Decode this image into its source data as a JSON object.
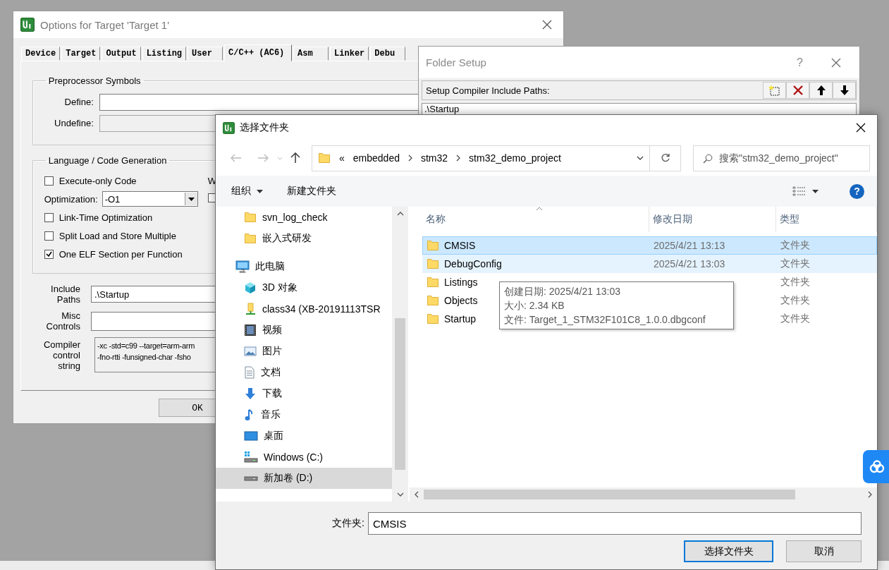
{
  "options_window": {
    "title": "Options for Target 'Target 1'",
    "tabs": [
      {
        "label": "Device",
        "selected": false
      },
      {
        "label": "Target",
        "selected": false
      },
      {
        "label": "Output",
        "selected": false
      },
      {
        "label": "Listing",
        "selected": false
      },
      {
        "label": "User",
        "selected": false
      },
      {
        "label": "C/C++ (AC6)",
        "selected": true
      },
      {
        "label": "Asm",
        "selected": false
      },
      {
        "label": "Linker",
        "selected": false
      },
      {
        "label": "Debu",
        "selected": false
      }
    ],
    "preprocessor": {
      "title": "Preprocessor Symbols",
      "define_label": "Define:",
      "undefine_label": "Undefine:",
      "undefine_disabled": true
    },
    "language": {
      "title": "Language / Code Generation",
      "options": [
        {
          "label": "Execute-only Code",
          "checked": false
        },
        {
          "label": "Link-Time Optimization",
          "checked": false
        },
        {
          "label": "Split Load and Store Multiple",
          "checked": false
        },
        {
          "label": "One ELF Section per Function",
          "checked": true
        }
      ],
      "optimization_label": "Optimization:",
      "optimization_value": "-O1",
      "column_2_label": "W",
      "column_2_checkbox_checked": false
    },
    "include_paths_label": "Include Paths",
    "include_paths_value": ".\\Startup",
    "misc_controls_label": "Misc Controls",
    "compiler_string_label": "Compiler control string",
    "compiler_string_lines": [
      "-xc -std=c99 --target=arm-arm",
      "-fno-rtti -funsigned-char -fsho"
    ],
    "ok_button": "OK"
  },
  "folder_setup": {
    "title": "Folder Setup",
    "help": "?",
    "toolbar_label": "Setup Compiler Include Paths:",
    "paths": [
      ".\\Startup"
    ]
  },
  "folder_dialog": {
    "title": "选择文件夹",
    "breadcrumb_overflow": "«",
    "breadcrumb": [
      "embedded",
      "stm32",
      "stm32_demo_project"
    ],
    "search_placeholder": "搜索\"stm32_demo_project\"",
    "toolbar": {
      "organize": "组织",
      "new_folder": "新建文件夹",
      "help": "?"
    },
    "nav_above": [
      {
        "label": "svn_log_check",
        "kind": "folder",
        "selected": false
      },
      {
        "label": "嵌入式研发",
        "kind": "folder",
        "selected": false
      }
    ],
    "nav_tree": [
      {
        "label": "此电脑",
        "kind": "pc",
        "selected": false,
        "children": [
          {
            "label": "3D 对象",
            "kind": "cube",
            "selected": false
          },
          {
            "label": "class34 (XB-20191113TSR",
            "kind": "network",
            "selected": false
          },
          {
            "label": "视频",
            "kind": "video",
            "selected": false
          },
          {
            "label": "图片",
            "kind": "pictures",
            "selected": false
          },
          {
            "label": "文档",
            "kind": "documents",
            "selected": false
          },
          {
            "label": "下载",
            "kind": "downloads",
            "selected": false
          },
          {
            "label": "音乐",
            "kind": "music",
            "selected": false
          },
          {
            "label": "桌面",
            "kind": "desktop",
            "selected": false
          },
          {
            "label": "Windows (C:)",
            "kind": "system_drive",
            "selected": false
          },
          {
            "label": "新加卷 (D:)",
            "kind": "drive",
            "selected": true
          }
        ]
      }
    ],
    "columns": [
      "名称",
      "修改日期",
      "类型"
    ],
    "rows": [
      {
        "name": "CMSIS",
        "date": "2025/4/21 13:13",
        "type": "文件夹",
        "selected": true,
        "hovered": false
      },
      {
        "name": "DebugConfig",
        "date": "2025/4/21 13:03",
        "type": "文件夹",
        "selected": false,
        "hovered": true
      },
      {
        "name": "Listings",
        "type": "文件夹",
        "selected": false,
        "hovered": false
      },
      {
        "name": "Objects",
        "type": "文件夹",
        "selected": false,
        "hovered": false
      },
      {
        "name": "Startup",
        "type": "文件夹",
        "selected": false,
        "hovered": false
      }
    ],
    "tooltip": [
      "创建日期: 2025/4/21 13:03",
      "大小: 2.34 KB",
      "文件: Target_1_STM32F101C8_1.0.0.dbgconf"
    ],
    "folder_label": "文件夹:",
    "folder_value": "CMSIS",
    "select_button": "选择文件夹",
    "cancel_button": "取消"
  }
}
